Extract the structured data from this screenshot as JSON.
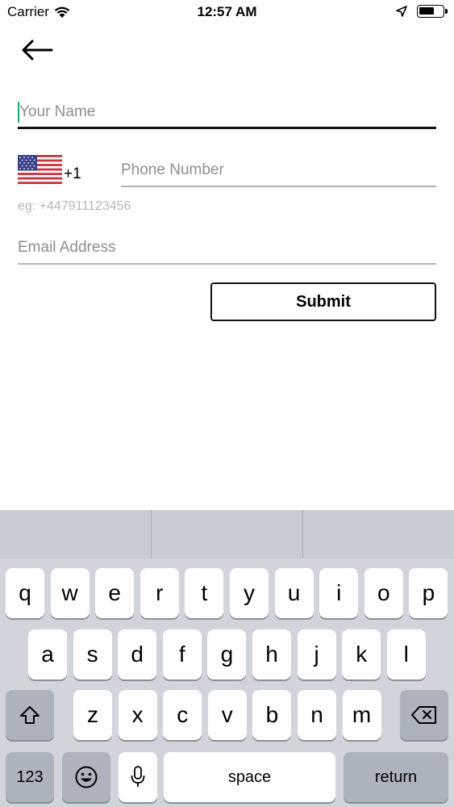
{
  "status_bar": {
    "carrier": "Carrier",
    "time": "12:57 AM",
    "icons": [
      "wifi-icon",
      "location-arrow-icon",
      "battery-icon"
    ]
  },
  "nav": {
    "back_icon": "arrow-left-icon"
  },
  "form": {
    "name_placeholder": "Your Name",
    "country_flag": "us-flag-icon",
    "dial_code": "+1",
    "phone_placeholder": "Phone Number",
    "phone_hint": "eg: +447911123456",
    "email_placeholder": "Email Address",
    "submit_label": "Submit"
  },
  "keyboard": {
    "row1": [
      "q",
      "w",
      "e",
      "r",
      "t",
      "y",
      "u",
      "i",
      "o",
      "p"
    ],
    "row2": [
      "a",
      "s",
      "d",
      "f",
      "g",
      "h",
      "j",
      "k",
      "l"
    ],
    "row3": [
      "z",
      "x",
      "c",
      "v",
      "b",
      "n",
      "m"
    ],
    "numbers_label": "123",
    "space_label": "space",
    "return_label": "return",
    "icons": [
      "shift-icon",
      "backspace-icon",
      "emoji-icon",
      "microphone-icon"
    ]
  },
  "colors": {
    "accent_caret": "#1fa57a",
    "keyboard_background": "#d1d4da",
    "key_dark": "#acb3bd"
  }
}
